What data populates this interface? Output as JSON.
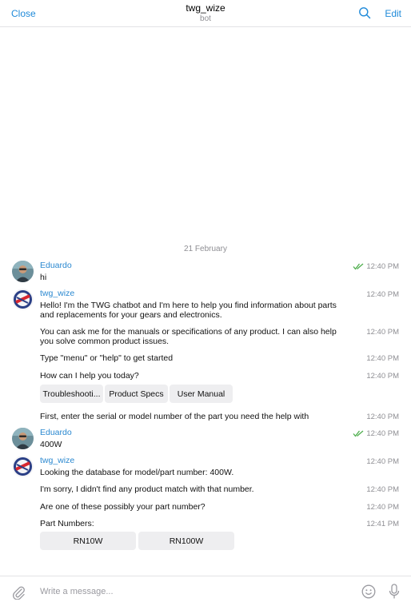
{
  "header": {
    "close_label": "Close",
    "title": "twg_wize",
    "subtitle": "bot",
    "edit_label": "Edit"
  },
  "chat": {
    "date": "21 February",
    "messages": [
      {
        "sender": "Eduardo",
        "text": "hi",
        "time": "12:40 PM",
        "read": true
      },
      {
        "sender": "twg_wize",
        "text": "Hello! I'm the TWG chatbot and I'm here to help you find information about parts and replacements for your gears and electronics.",
        "time": "12:40 PM"
      },
      {
        "text": "You can ask me for the manuals or specifications of any product. I can also help you solve common product issues.",
        "time": "12:40 PM"
      },
      {
        "text": "Type \"menu\" or \"help\" to get started",
        "time": "12:40 PM"
      },
      {
        "text": "How can I help you today?",
        "time": "12:40 PM"
      },
      {
        "text": "First, enter the serial or model number of the part you need the help with",
        "time": "12:40 PM"
      },
      {
        "sender": "Eduardo",
        "text": "400W",
        "time": "12:40 PM",
        "read": true
      },
      {
        "sender": "twg_wize",
        "text": "Looking the database for model/part number: 400W.",
        "time": "12:40 PM"
      },
      {
        "text": "I'm sorry, I didn't find any product match with that number.",
        "time": "12:40 PM"
      },
      {
        "text": "Are one of these possibly your part number?",
        "time": "12:40 PM"
      },
      {
        "text": "Part Numbers:",
        "time": "12:41 PM"
      }
    ],
    "keyboard1": [
      "Troubleshooti...",
      "Product Specs",
      "User Manual"
    ],
    "keyboard2": [
      "RN10W",
      "RN100W"
    ]
  },
  "composer": {
    "placeholder": "Write a message..."
  },
  "colors": {
    "accent": "#1f8ad9",
    "sender_name": "#2a88d0",
    "read_check": "#4fae4e"
  },
  "icons": [
    "search-icon",
    "double-check-icon",
    "paperclip-icon",
    "emoji-icon",
    "microphone-icon"
  ]
}
